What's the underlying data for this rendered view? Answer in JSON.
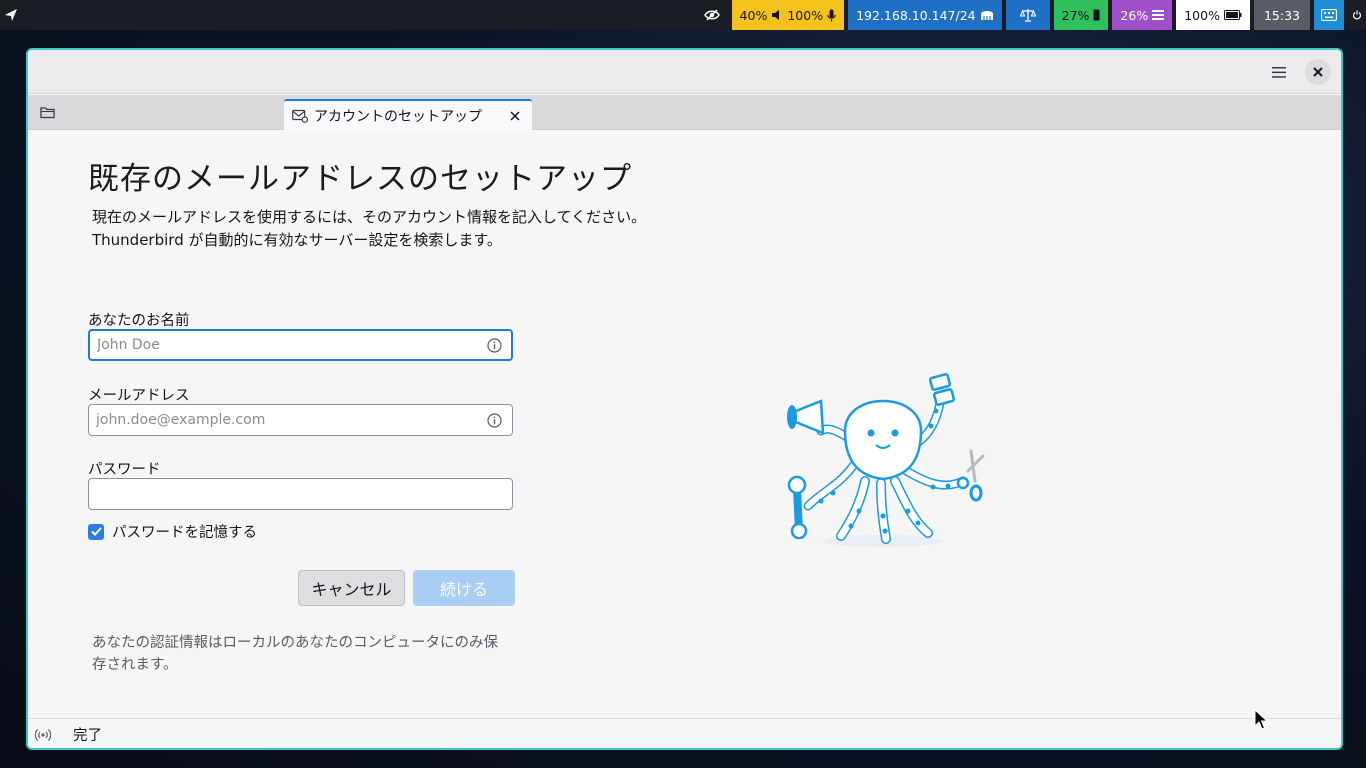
{
  "topbar": {
    "volume": "40%",
    "mic": "100%",
    "network": "192.168.10.147/24",
    "cpu": "27%",
    "memory": "26%",
    "battery": "100%",
    "clock": "15:33",
    "colors": {
      "bar": "#1a1d24",
      "audio": "#f4c21a",
      "network": "#1f6fc4",
      "balance": "#1f6fc4",
      "cpu": "#2fbf5d",
      "memory": "#9f4fc7",
      "battery": "#ffffff",
      "clock": "#5a5d66",
      "keyboard": "#1f8ed6"
    }
  },
  "window": {
    "border_color": "#3ec6c8",
    "tab": {
      "label": "アカウントのセットアップ"
    }
  },
  "setup": {
    "heading": "既存のメールアドレスのセットアップ",
    "description_line1": "現在のメールアドレスを使用するには、そのアカウント情報を記入してください。",
    "description_line2": "Thunderbird が自動的に有効なサーバー設定を検索します。",
    "name_label": "あなたのお名前",
    "name_placeholder": "John Doe",
    "name_value": "",
    "email_label": "メールアドレス",
    "email_placeholder": "john.doe@example.com",
    "email_value": "",
    "password_label": "パスワード",
    "password_value": "",
    "remember_label": "パスワードを記憶する",
    "remember_checked": true,
    "cancel_label": "キャンセル",
    "continue_label": "続ける",
    "note_line1": "あなたの認証情報はローカルのあなたのコンピュータにのみ保",
    "note_line2": "存されます。",
    "accent": "#1c7dd6"
  },
  "statusbar": {
    "status": "完了"
  }
}
